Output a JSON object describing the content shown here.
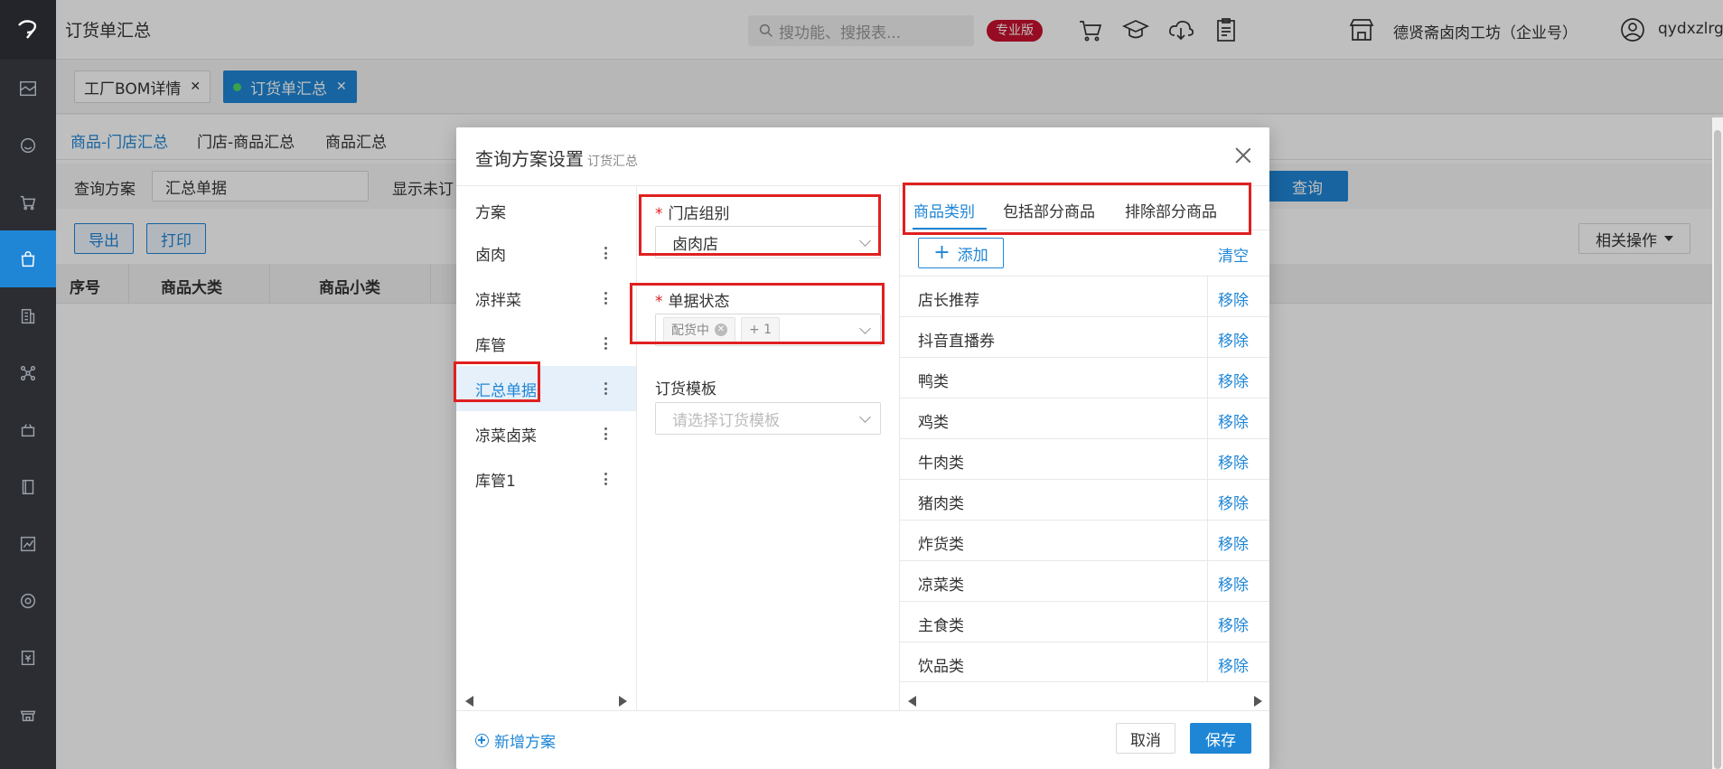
{
  "header": {
    "title": "订货单汇总",
    "search_placeholder": "搜功能、搜报表...",
    "edition_badge": "专业版",
    "store_name": "德贤斋卤肉工坊（企业号）",
    "user_name": "qydxzlrgc",
    "icons": [
      "cart-icon",
      "graduation-cap-icon",
      "cloud-download-icon",
      "clipboard-icon",
      "store-icon",
      "user-circle-icon"
    ]
  },
  "page_tabs": [
    {
      "label": "工厂BOM详情",
      "active": false
    },
    {
      "label": "订货单汇总",
      "active": true
    }
  ],
  "sub_tabs": [
    {
      "label": "商品-门店汇总",
      "active": true
    },
    {
      "label": "门店-商品汇总",
      "active": false
    },
    {
      "label": "商品汇总",
      "active": false
    }
  ],
  "query": {
    "plan_label": "查询方案",
    "plan_value": "汇总单据",
    "show_unordered_partial": "显示未订",
    "query_button_partial": "查询"
  },
  "actions": {
    "export": "导出",
    "print": "打印",
    "related": "相关操作"
  },
  "table": {
    "columns": [
      "序号",
      "商品大类",
      "商品小类"
    ]
  },
  "modal": {
    "title": "查询方案设置",
    "subtitle": "订货汇总",
    "plan_header": "方案",
    "plans": [
      {
        "label": "卤肉",
        "active": false
      },
      {
        "label": "凉拌菜",
        "active": false
      },
      {
        "label": "库管",
        "active": false
      },
      {
        "label": "汇总单据",
        "active": true
      },
      {
        "label": "凉菜卤菜",
        "active": false
      },
      {
        "label": "库管1",
        "active": false
      }
    ],
    "store_group_label": "门店组别",
    "store_group_value": "卤肉店",
    "doc_status_label": "单据状态",
    "doc_status_tag": "配货中",
    "doc_status_more": "+ 1",
    "template_label": "订货模板",
    "template_placeholder": "请选择订货模板",
    "right_tabs": [
      {
        "label": "商品类别",
        "active": true
      },
      {
        "label": "包括部分商品",
        "active": false
      },
      {
        "label": "排除部分商品",
        "active": false
      }
    ],
    "add_label": "添加",
    "clear_label": "清空",
    "remove_label": "移除",
    "categories": [
      "店长推荐",
      "抖音直播券",
      "鸭类",
      "鸡类",
      "牛肉类",
      "猪肉类",
      "炸货类",
      "凉菜类",
      "主食类",
      "饮品类"
    ],
    "new_plan": "新增方案",
    "cancel": "取消",
    "save": "保存"
  },
  "colors": {
    "accent": "#1f86d6",
    "highlight_box": "#e02020",
    "nav_bg": "#2b2d33",
    "badge": "#c8102e"
  }
}
